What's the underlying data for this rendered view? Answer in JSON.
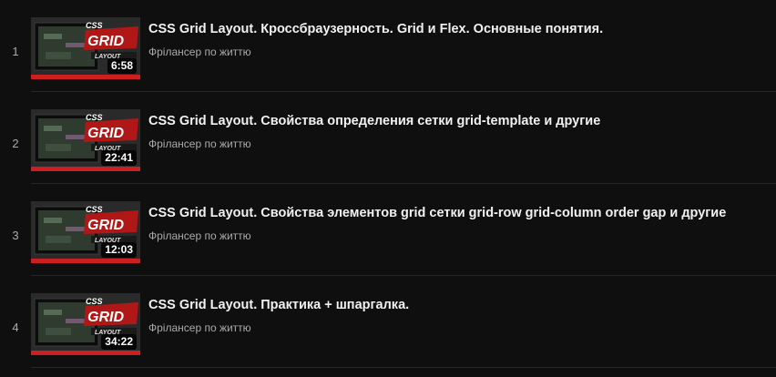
{
  "playlist": {
    "items": [
      {
        "index": "1",
        "title": "CSS Grid Layout. Кроссбраузерность. Grid и Flex. Основные понятия.",
        "channel": "Фрілансер по життю",
        "duration": "6:58"
      },
      {
        "index": "2",
        "title": "CSS Grid Layout. Свойства определения сетки grid-template и другие",
        "channel": "Фрілансер по життю",
        "duration": "22:41"
      },
      {
        "index": "3",
        "title": "CSS Grid Layout. Свойства элементов grid сетки grid-row grid-column order gap и другие",
        "channel": "Фрілансер по життю",
        "duration": "12:03"
      },
      {
        "index": "4",
        "title": "CSS Grid Layout. Практика + шпаргалка.",
        "channel": "Фрілансер по життю",
        "duration": "34:22"
      }
    ]
  },
  "thumbnail": {
    "css_text": "CSS",
    "grid_text": "GRID",
    "layout_text": "LAYOUT",
    "icon": "video-thumbnail"
  },
  "colors": {
    "background": "#0f0f0f",
    "accent_red": "#cc1f1f",
    "title": "#f1f1f1",
    "secondary": "#aaaaaa"
  }
}
